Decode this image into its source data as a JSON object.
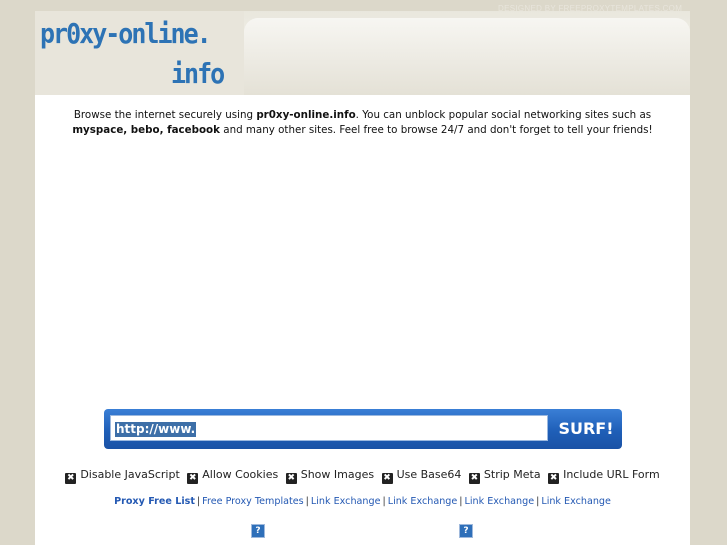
{
  "credit": "DESIGNED BY FREEPROXYTEMPLATES.COM",
  "logo": {
    "line1": "pr0xy-online.",
    "line2": "info"
  },
  "intro": {
    "t1": "Browse the internet securely using ",
    "b1": "pr0xy-online.info",
    "t2": ". You can unblock popular social networking sites such as ",
    "b2": "myspace, bebo, facebook",
    "t3": " and many other sites. Feel free to browse 24/7 and don't forget to tell your friends!"
  },
  "form": {
    "url_value": "http://www.",
    "submit_label": "SURF!"
  },
  "options": [
    {
      "label": "Disable JavaScript",
      "checked": true
    },
    {
      "label": "Allow Cookies",
      "checked": true
    },
    {
      "label": "Show Images",
      "checked": true
    },
    {
      "label": "Use Base64",
      "checked": true
    },
    {
      "label": "Strip Meta",
      "checked": true
    },
    {
      "label": "Include URL Form",
      "checked": true
    }
  ],
  "links": [
    "Proxy Free List",
    "Free Proxy Templates",
    "Link Exchange",
    "Link Exchange",
    "Link Exchange",
    "Link Exchange"
  ],
  "icons": {
    "broken_image": "question-mark-icon",
    "checkbox": "checked-box-icon"
  }
}
